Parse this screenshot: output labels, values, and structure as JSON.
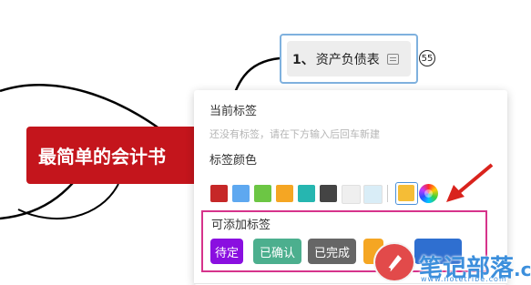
{
  "mindmap": {
    "root_title": "最简单的会计书",
    "child_number": "1、",
    "child_title": "资产负债表",
    "badge": "55",
    "root_color": "#c4151c",
    "child_border_color": "#7fb1de"
  },
  "tag_panel": {
    "current_tags_title": "当前标签",
    "no_tags_hint": "还没有标签，请在下方输入后回车新建",
    "tag_color_title": "标签颜色",
    "colors": [
      "#c62828",
      "#5ea8f0",
      "#6cc644",
      "#f5a623",
      "#26b6b0",
      "#444444",
      "#efefef",
      "#d9edf7"
    ],
    "selected_color": "#f5bd36",
    "addable_tags_title": "可添加标签",
    "tags": [
      {
        "label": "待定",
        "color": "#8a0fe0"
      },
      {
        "label": "已确认",
        "color": "#4caf8e"
      },
      {
        "label": "已完成",
        "color": "#666666"
      },
      {
        "label": "",
        "color": "#f5a623"
      },
      {
        "label": "",
        "color": "#2f6fd0"
      }
    ]
  },
  "watermark": {
    "text": "笔记部落",
    "domain": ".cn",
    "sub": "www.notetribe.com"
  }
}
